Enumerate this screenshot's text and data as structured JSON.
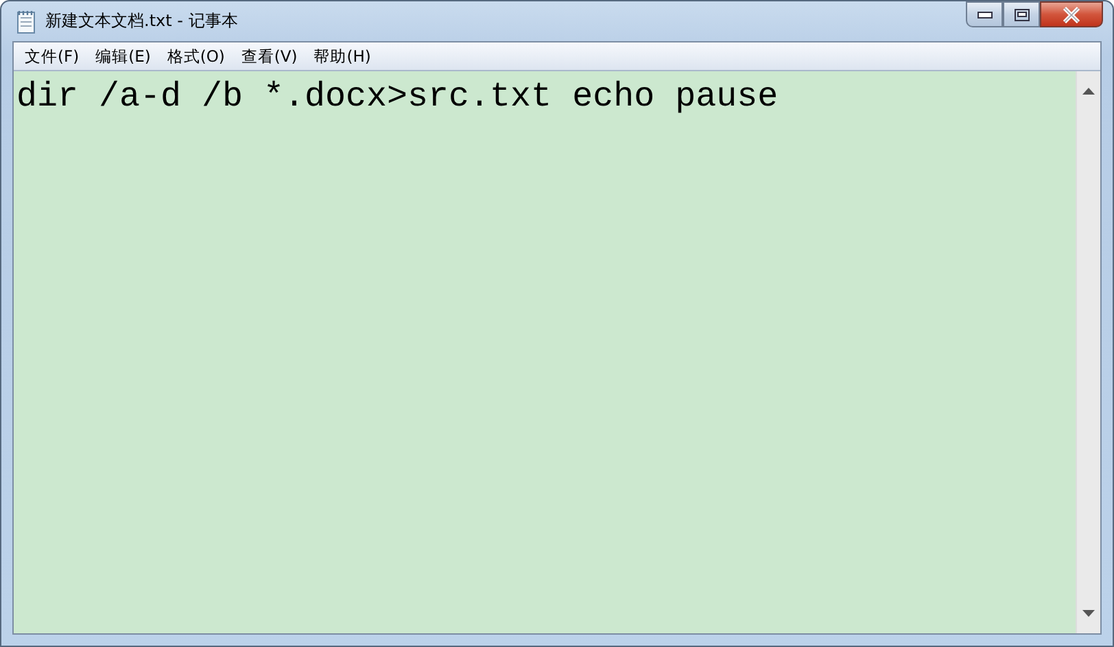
{
  "window": {
    "title": "新建文本文档.txt - 记事本"
  },
  "menu": [
    "文件(F)",
    "编辑(E)",
    "格式(O)",
    "查看(V)",
    "帮助(H)"
  ],
  "editor": {
    "text": "dir /a-d /b *.docx>src.txt echo pause"
  }
}
